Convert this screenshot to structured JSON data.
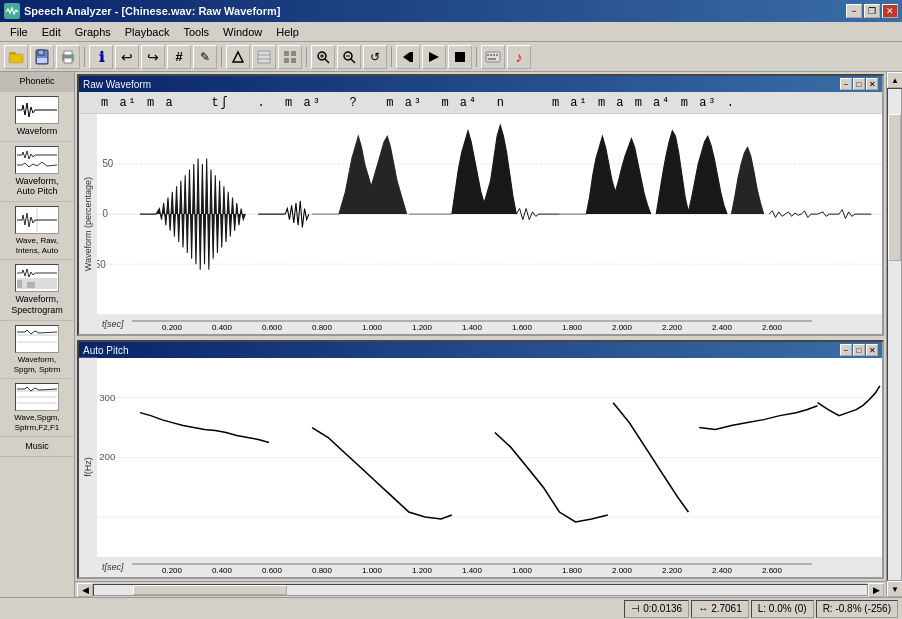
{
  "titleBar": {
    "title": "Speech Analyzer - [Chinese.wav: Raw Waveform]",
    "iconLabel": "SA",
    "minimize": "−",
    "maximize": "□",
    "close": "✕",
    "restore": "❐"
  },
  "menuBar": {
    "items": [
      "File",
      "Edit",
      "Graphs",
      "Playback",
      "Tools",
      "Window",
      "Help"
    ]
  },
  "toolbar": {
    "buttons": [
      {
        "icon": "🗁",
        "name": "open"
      },
      {
        "icon": "💾",
        "name": "save"
      },
      {
        "icon": "🖨",
        "name": "print"
      },
      {
        "icon": "ℹ",
        "name": "info"
      },
      {
        "icon": "↩",
        "name": "undo"
      },
      {
        "icon": "↪",
        "name": "redo"
      },
      {
        "icon": "#",
        "name": "hash"
      },
      {
        "icon": "✎",
        "name": "edit"
      },
      {
        "icon": "△",
        "name": "triangle"
      },
      {
        "icon": "▤",
        "name": "spectrogram"
      },
      {
        "icon": "⊞",
        "name": "grid"
      },
      {
        "icon": "🔍",
        "name": "zoom-in"
      },
      {
        "icon": "🔍",
        "name": "zoom-out"
      },
      {
        "icon": "↺",
        "name": "loop"
      },
      {
        "icon": "⏮",
        "name": "prev"
      },
      {
        "icon": "▶",
        "name": "play"
      },
      {
        "icon": "⏹",
        "name": "stop"
      },
      {
        "icon": "⌨",
        "name": "keyboard"
      },
      {
        "icon": "♪",
        "name": "music"
      }
    ]
  },
  "sidebar": {
    "items": [
      {
        "label": "Phonetic",
        "icon": "wave1"
      },
      {
        "label": "Waveform",
        "icon": "wave2"
      },
      {
        "label": "Waveform,\nAuto Pitch",
        "icon": "wave3"
      },
      {
        "label": "Wave, Raw,\nIntens, Auto",
        "icon": "wave4"
      },
      {
        "label": "Waveform,\nSpectrogram",
        "icon": "wave5"
      },
      {
        "label": "Waveform,\nSpgm, Sptrm",
        "icon": "wave6"
      },
      {
        "label": "Wave,Spgm,\nSptrm,F2,F1",
        "icon": "wave7"
      },
      {
        "label": "Music",
        "icon": "music"
      }
    ]
  },
  "panels": {
    "rawWaveform": {
      "title": "Raw Waveform",
      "phonetic": "m a¹ m a   tʃ  . m a³  ?  m a³  m a⁴  n    m a¹ m a m a⁴ m a³ .",
      "phonetic_tokens": [
        "m",
        " ",
        "a¹",
        " ",
        "m",
        " ",
        "a",
        " ",
        " ",
        " ",
        "tʃ",
        " ",
        " ",
        ".",
        " ",
        "m",
        " ",
        "a³",
        " ",
        " ",
        "?",
        " ",
        " ",
        "m",
        " ",
        "a³",
        " ",
        " ",
        "m",
        " ",
        "a⁴",
        " ",
        " ",
        "n",
        " ",
        " ",
        " ",
        " ",
        "m",
        " ",
        "a¹",
        " ",
        "m",
        " ",
        "a",
        " ",
        "m",
        " ",
        "a⁴",
        " ",
        "m",
        " ",
        "a³",
        " ",
        "."
      ],
      "yAxisLabel": "Waveform (percentage)",
      "xAxisLabel": "t[sec]",
      "xTicks": [
        "0.200",
        "0.400",
        "0.600",
        "0.800",
        "1.000",
        "1.200",
        "1.400",
        "1.600",
        "1.800",
        "2.000",
        "2.200",
        "2.400",
        "2.600"
      ],
      "yTicks": [
        "50",
        "0",
        "-50"
      ],
      "controls": [
        "−",
        "□",
        "✕"
      ]
    },
    "autoPitch": {
      "title": "Auto Pitch",
      "yAxisLabel": "f(Hz)",
      "xAxisLabel": "t[sec]",
      "xTicks": [
        "0.200",
        "0.400",
        "0.600",
        "0.800",
        "1.000",
        "1.200",
        "1.400",
        "1.600",
        "1.800",
        "2.000",
        "2.200",
        "2.400",
        "2.600"
      ],
      "yTicks": [
        "300",
        "200"
      ],
      "controls": [
        "−",
        "□",
        "✕"
      ]
    }
  },
  "statusBar": {
    "cursor": "0:0.0136",
    "duration": "2.7061",
    "left": "L: 0.0%  (0)",
    "right": "R: -0.8%  (-256)",
    "cursorLabel": "cursor-icon",
    "durationLabel": "duration-icon"
  }
}
